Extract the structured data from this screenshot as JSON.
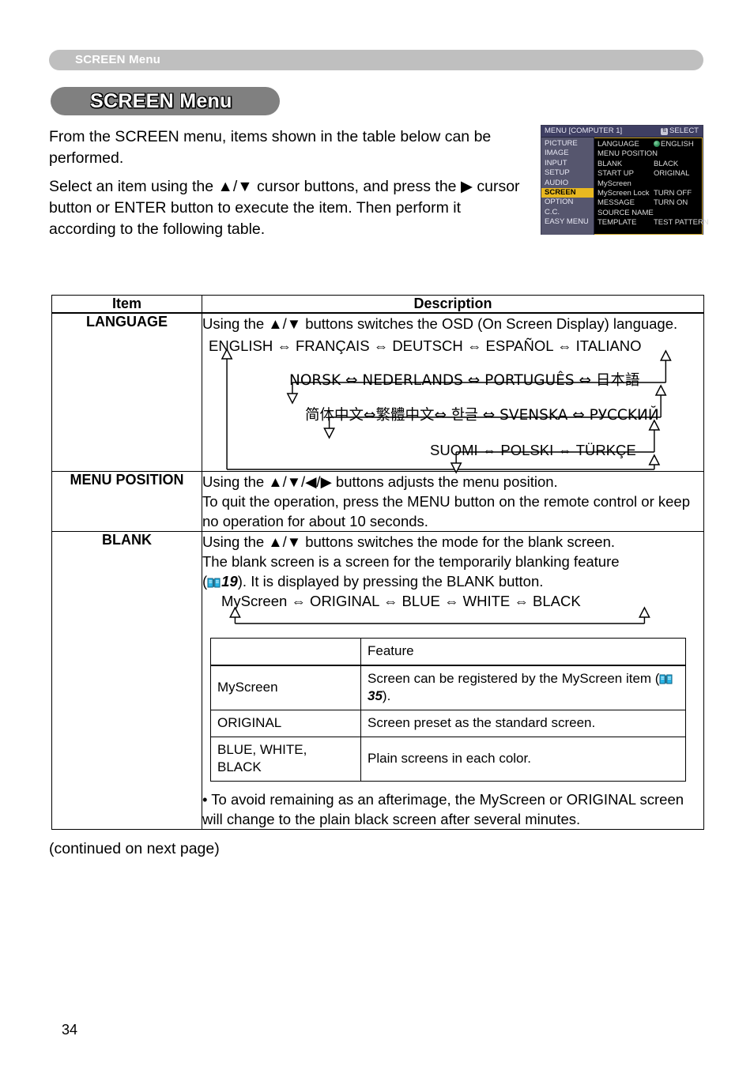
{
  "running_header": {
    "text": "SCREEN Menu"
  },
  "title_pill": {
    "text": "SCREEN Menu"
  },
  "intro": {
    "para1": "From the SCREEN menu, items shown in the table below can be performed.",
    "para2": "Select an item using the ▲/▼ cursor buttons, and press the ▶ cursor button or ENTER button to execute the item. Then perform it according to the following table."
  },
  "osd": {
    "title": "MENU [COMPUTER 1]",
    "select_label": "SELECT",
    "select_key_glyph": "⇅",
    "left_items": [
      {
        "label": "PICTURE",
        "selected": false
      },
      {
        "label": "IMAGE",
        "selected": false
      },
      {
        "label": "INPUT",
        "selected": false
      },
      {
        "label": "SETUP",
        "selected": false
      },
      {
        "label": "AUDIO",
        "selected": false
      },
      {
        "label": "SCREEN",
        "selected": true
      },
      {
        "label": "OPTION",
        "selected": false
      },
      {
        "label": "C.C.",
        "selected": false
      },
      {
        "label": "EASY MENU",
        "selected": false
      }
    ],
    "rows": [
      {
        "label": "LANGUAGE",
        "value": "ENGLISH",
        "has_globe": true
      },
      {
        "label": "MENU POSITION",
        "value": "",
        "has_globe": false
      },
      {
        "label": "BLANK",
        "value": "BLACK",
        "has_globe": false
      },
      {
        "label": "START UP",
        "value": "ORIGINAL",
        "has_globe": false
      },
      {
        "label": "MyScreen",
        "value": "",
        "has_globe": false
      },
      {
        "label": "MyScreen Lock",
        "value": "TURN OFF",
        "has_globe": false
      },
      {
        "label": "MESSAGE",
        "value": "TURN ON",
        "has_globe": false
      },
      {
        "label": "SOURCE NAME",
        "value": "",
        "has_globe": false
      },
      {
        "label": "TEMPLATE",
        "value": "TEST PATTERN",
        "has_globe": false
      }
    ],
    "colors": {
      "highlight": "#e8b820",
      "title_bar": "#3f3f63",
      "sidebar": "#56566e",
      "panel_border": "#c8a020"
    }
  },
  "table": {
    "header_item": "Item",
    "header_description": "Description",
    "rows": {
      "language": {
        "item": "LANGUAGE",
        "intro": "Using the ▲/▼ buttons switches the OSD (On Screen Display) language.",
        "cycle_lines": [
          "ENGLISH ⇔ FRANÇAIS ⇔ DEUTSCH ⇔ ESPAÑOL ⇔ ITALIANO",
          "NORSK ⇔ NEDERLANDS ⇔ PORTUGUÊS ⇔ 日本語",
          "简体中文⇔繁體中文⇔ 한글 ⇔ SVENSKA ⇔ PУCCKИЙ",
          "SUOMI ⇔ POLSKI ⇔ TÜRKÇE"
        ]
      },
      "menu_position": {
        "item": "MENU POSITION",
        "line1": "Using the ▲/▼/◀/▶ buttons adjusts the menu position.",
        "line2": "To quit the operation, press the MENU button on the remote control or keep no operation for about 10 seconds."
      },
      "blank": {
        "item": "BLANK",
        "line1": "Using the ▲/▼ buttons switches the mode for the blank screen.",
        "line2": "The blank screen is a screen for the temporarily blanking feature",
        "line3_prefix": "(",
        "line3_page": "19",
        "line3_suffix": ").  It is displayed by pressing the BLANK button.",
        "cycle_line": "MyScreen ⇔ ORIGINAL ⇔ BLUE ⇔ WHITE ⇔ BLACK",
        "feature_table": {
          "header_blank": "",
          "header_feature": "Feature",
          "rows": [
            {
              "mode": "MyScreen",
              "desc_prefix": "Screen can be registered by the MyScreen item (",
              "desc_page": "35",
              "desc_suffix": ")."
            },
            {
              "mode": "ORIGINAL",
              "desc_prefix": "Screen preset as the standard screen.",
              "desc_page": "",
              "desc_suffix": ""
            },
            {
              "mode": "BLUE, WHITE, BLACK",
              "desc_prefix": "Plain screens in each color.",
              "desc_page": "",
              "desc_suffix": ""
            }
          ]
        },
        "note": "• To avoid remaining as an afterimage, the MyScreen or ORIGINAL screen will change to the plain black screen after several minutes."
      }
    }
  },
  "footer": {
    "continued": "(continued on next page)",
    "page_number": "34"
  }
}
